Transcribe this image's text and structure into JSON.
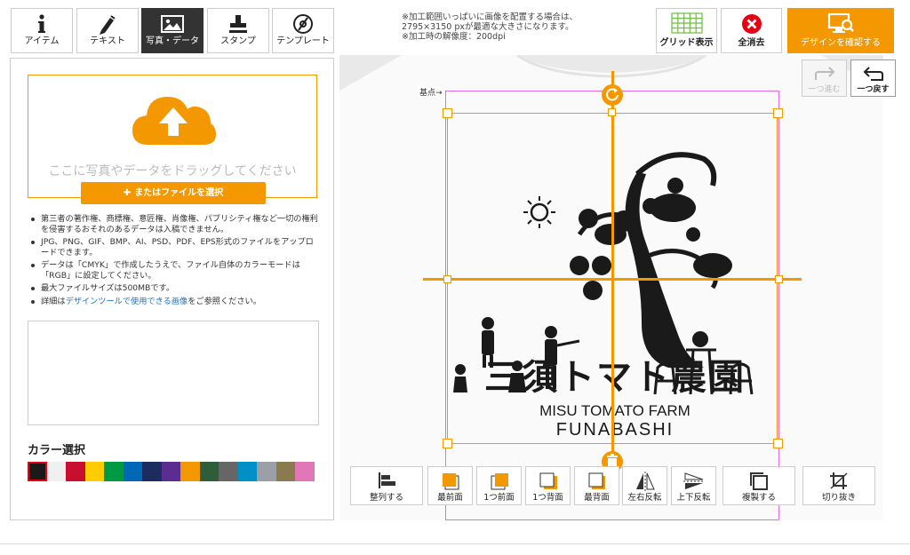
{
  "toolbar": {
    "tabs": [
      {
        "label": "アイテム",
        "icon": "info-icon"
      },
      {
        "label": "テキスト",
        "icon": "pen-icon"
      },
      {
        "label": "写真・データ",
        "icon": "image-icon",
        "active": true
      },
      {
        "label": "スタンプ",
        "icon": "stamp-icon"
      },
      {
        "label": "テンプレート",
        "icon": "template-icon"
      }
    ],
    "notes": [
      "※加工範囲いっぱいに画像を配置する場合は、",
      "2795×3150 pxが最適な大きさになります。",
      "※加工時の解像度：200dpi"
    ],
    "grid_label": "グリッド表示",
    "clear_label": "全消去",
    "confirm_label": "デザインを確認する"
  },
  "upload": {
    "drop_text": "ここに写真やデータをドラッグしてください",
    "file_button": "またはファイルを選択",
    "notes": [
      "第三者の著作権、商標権、意匠権、肖像権、パブリシティ権など一切の権利を侵害するおそれのあるデータは入稿できません。",
      "JPG、PNG、GIF、BMP、AI、PSD、PDF、EPS形式のファイルをアップロードできます。",
      "データは「CMYK」で作成したうえで、ファイル自体のカラーモードは「RGB」に設定してください。",
      "最大ファイルサイズは500MBです。"
    ],
    "note_last_prefix": "詳細は",
    "note_last_link": "デザインツールで使用できる画像",
    "note_last_suffix": "をご参照ください。"
  },
  "color": {
    "title": "カラー選択",
    "swatches": [
      "#1a1a1a",
      "#f0f0f0",
      "#c8102e",
      "#ffcc00",
      "#009944",
      "#0068b7",
      "#1d2c5e",
      "#5c2d91",
      "#f39800",
      "#2e5d3a",
      "#666666",
      "#0090c8",
      "#9aa0a6",
      "#8a7a4f",
      "#e277b7"
    ]
  },
  "canvas": {
    "basepoint_label": "基点→",
    "design_text_jp": "三須トマト農園",
    "design_text_en1": "MISU TOMATO FARM",
    "design_text_en2": "FUNABASHI"
  },
  "history": {
    "redo_label": "一つ進む",
    "undo_label": "一つ戻す"
  },
  "actions": [
    {
      "label": "整列する",
      "name": "align-button"
    },
    {
      "label": "最前面",
      "name": "bring-front-button"
    },
    {
      "label": "1つ前面",
      "name": "bring-forward-button"
    },
    {
      "label": "1つ背面",
      "name": "send-backward-button"
    },
    {
      "label": "最背面",
      "name": "send-back-button"
    },
    {
      "label": "左右反転",
      "name": "flip-horizontal-button"
    },
    {
      "label": "上下反転",
      "name": "flip-vertical-button"
    },
    {
      "label": "複製する",
      "name": "duplicate-button"
    },
    {
      "label": "切り抜き",
      "name": "crop-button"
    }
  ]
}
